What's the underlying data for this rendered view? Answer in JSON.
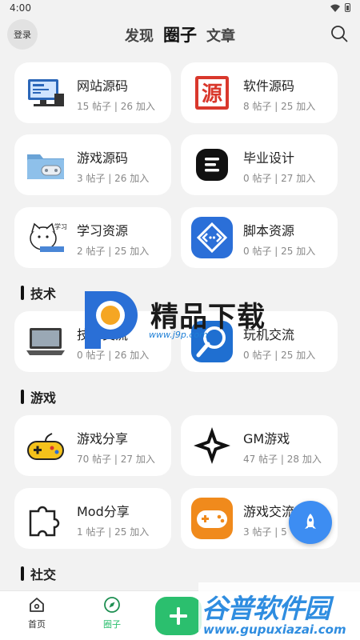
{
  "status": {
    "time": "4:00"
  },
  "header": {
    "login_label": "登录",
    "tabs": [
      {
        "label": "发现",
        "active": false
      },
      {
        "label": "圈子",
        "active": true
      },
      {
        "label": "文章",
        "active": false
      }
    ]
  },
  "sections": {
    "tech": "技术",
    "games": "游戏",
    "social": "社交"
  },
  "cards": [
    {
      "name": "网站源码",
      "stats": "15 帖子 | 26 加入",
      "icon": "computer-code-icon"
    },
    {
      "name": "软件源码",
      "stats": "8 帖子 | 25 加入",
      "icon": "source-seal-icon"
    },
    {
      "name": "游戏源码",
      "stats": "3 帖子 | 26 加入",
      "icon": "game-folder-icon"
    },
    {
      "name": "毕业设计",
      "stats": "0 帖子 | 27 加入",
      "icon": "document-lines-icon"
    },
    {
      "name": "学习资源",
      "stats": "2 帖子 | 25 加入",
      "icon": "cat-studying-icon"
    },
    {
      "name": "脚本资源",
      "stats": "0 帖子 | 25 加入",
      "icon": "script-code-icon"
    },
    {
      "name": "技术交流",
      "stats": "0 帖子 | 26 加入",
      "icon": "laptop-icon"
    },
    {
      "name": "玩机交流",
      "stats": "0 帖子 | 25 加入",
      "icon": "wrench-gear-icon"
    },
    {
      "name": "游戏分享",
      "stats": "70 帖子 | 27 加入",
      "icon": "gamepad-icon"
    },
    {
      "name": "GM游戏",
      "stats": "47 帖子 | 28 加入",
      "icon": "star-diamond-icon"
    },
    {
      "name": "Mod分享",
      "stats": "1 帖子 | 25 加入",
      "icon": "puzzle-piece-icon"
    },
    {
      "name": "游戏交流",
      "stats": "3 帖子 | 5",
      "icon": "orange-gamepad-icon"
    }
  ],
  "watermarks": {
    "brand": "精品下载",
    "url": "www.j9p.com",
    "brand2": "谷普软件园",
    "url2": "www.gupuxiazai.com"
  },
  "bottom_nav": {
    "home": "首页",
    "circle": "圈子",
    "add_icon": "plus-icon"
  },
  "colors": {
    "accent_green": "#2bbf6e",
    "fab_blue": "#3d8df2"
  }
}
